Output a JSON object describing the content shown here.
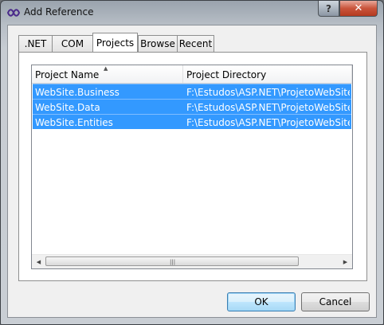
{
  "window": {
    "title": "Add Reference",
    "help_label": "?",
    "close_label": "✕"
  },
  "tabs": [
    {
      "label": ".NET"
    },
    {
      "label": "COM"
    },
    {
      "label": "Projects",
      "selected": true
    },
    {
      "label": "Browse"
    },
    {
      "label": "Recent"
    }
  ],
  "list": {
    "columns": [
      "Project Name",
      "Project Directory"
    ],
    "sort_indicator": "▲",
    "rows": [
      {
        "name": "WebSite.Business",
        "directory": "F:\\Estudos\\ASP.NET\\ProjetoWebSite\\WebSite.Business"
      },
      {
        "name": "WebSite.Data",
        "directory": "F:\\Estudos\\ASP.NET\\ProjetoWebSite\\WebSite.Data"
      },
      {
        "name": "WebSite.Entities",
        "directory": "F:\\Estudos\\ASP.NET\\ProjetoWebSite\\WebSite.Entities"
      }
    ],
    "selection_color": "#3399ff",
    "scroll": {
      "left_icon": "◀",
      "right_icon": "▶",
      "grip": "|||"
    }
  },
  "buttons": {
    "ok": "OK",
    "cancel": "Cancel"
  },
  "icons": {
    "app": "vs-reference-icon",
    "help": "help-icon",
    "close": "close-icon"
  }
}
